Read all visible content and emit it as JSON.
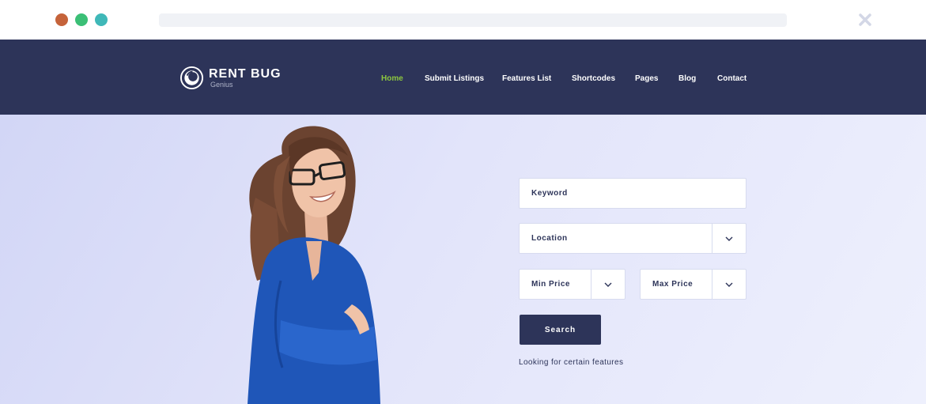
{
  "brand": {
    "title": "RENT BUG",
    "subtitle": "Genius"
  },
  "nav": {
    "items": [
      {
        "label": "Home",
        "active": true
      },
      {
        "label": "Submit Listings",
        "active": false
      },
      {
        "label": "Features List",
        "active": false
      },
      {
        "label": "Shortcodes",
        "active": false
      },
      {
        "label": "Pages",
        "active": false
      },
      {
        "label": "Blog",
        "active": false
      },
      {
        "label": "Contact",
        "active": false
      }
    ]
  },
  "search_form": {
    "keyword_placeholder": "Keyword",
    "location_placeholder": "Location",
    "min_price_placeholder": "Min Price",
    "max_price_placeholder": "Max Price",
    "search_label": "Search",
    "hint": "Looking for certain features"
  },
  "colors": {
    "header_bg": "#2d3459",
    "active_nav": "#8cc63f",
    "button_bg": "#2d3459"
  },
  "icons": {
    "dropdown": "chevron-down-icon",
    "logo": "logo-icon",
    "close": "close-icon"
  }
}
